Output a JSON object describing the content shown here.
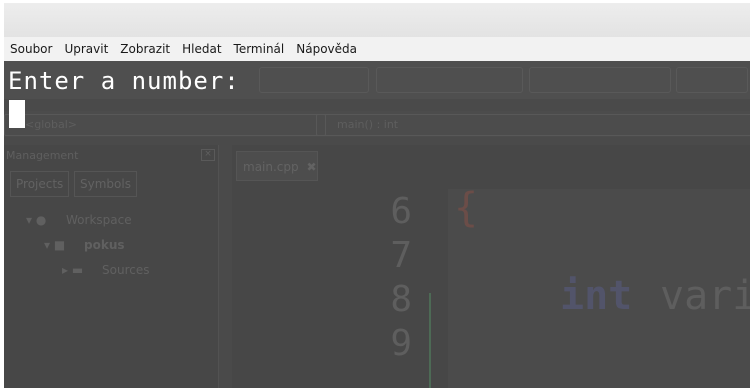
{
  "menubar": {
    "items": [
      "Soubor",
      "Upravit",
      "Zobrazit",
      "Hledat",
      "Terminál",
      "Nápověda"
    ]
  },
  "terminal": {
    "output_line": "Enter a number:"
  },
  "ide_background": {
    "scope_left": "<global>",
    "scope_right": "main() : int",
    "panel_title": "Management",
    "panel_tabs": [
      "Projects",
      "Symbols"
    ],
    "tree": [
      "Workspace",
      "pokus",
      "Sources"
    ],
    "editor_tab": "main.cpp",
    "line_numbers": [
      "6",
      "7",
      "8",
      "9"
    ],
    "brace": "{",
    "keyword": "int",
    "identifier": "vari"
  },
  "colors": {
    "terminal_bg": "#4a4a4a",
    "terminal_fg": "#ffffff",
    "menubar_bg": "#f2f2f2"
  }
}
